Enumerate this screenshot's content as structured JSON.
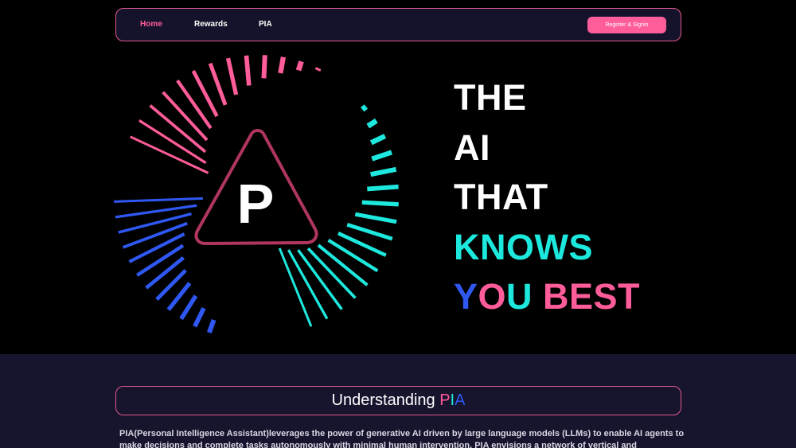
{
  "nav": {
    "links": [
      "Home",
      "Rewards",
      "PIA"
    ],
    "register_label": "Register & Signin"
  },
  "hero": {
    "logo_letter": "P",
    "lines": [
      "THE",
      "AI",
      "THAT",
      "KNOWS"
    ],
    "last_line_parts": [
      "Y",
      "O",
      "U",
      " BEST"
    ]
  },
  "section": {
    "title_prefix": "Understanding ",
    "title_p": "P",
    "title_i": "I",
    "title_a": "A",
    "description": "PIA(Personal Intelligence Assistant)leverages the power of generative AI driven by large language models (LLMs) to enable AI agents to make decisions and complete tasks autonomously with minimal human intervention. PIA envisions a network of vertical and personalized AI"
  },
  "colors": {
    "pink": "#ff5c9a",
    "cyan": "#1de8dd",
    "blue": "#2f58f2",
    "logo_triangle": "#b0365f",
    "nav_bg": "#15132b",
    "section_bg": "#17142e"
  },
  "icons": {
    "logo": "pia-radial-logo-icon"
  }
}
